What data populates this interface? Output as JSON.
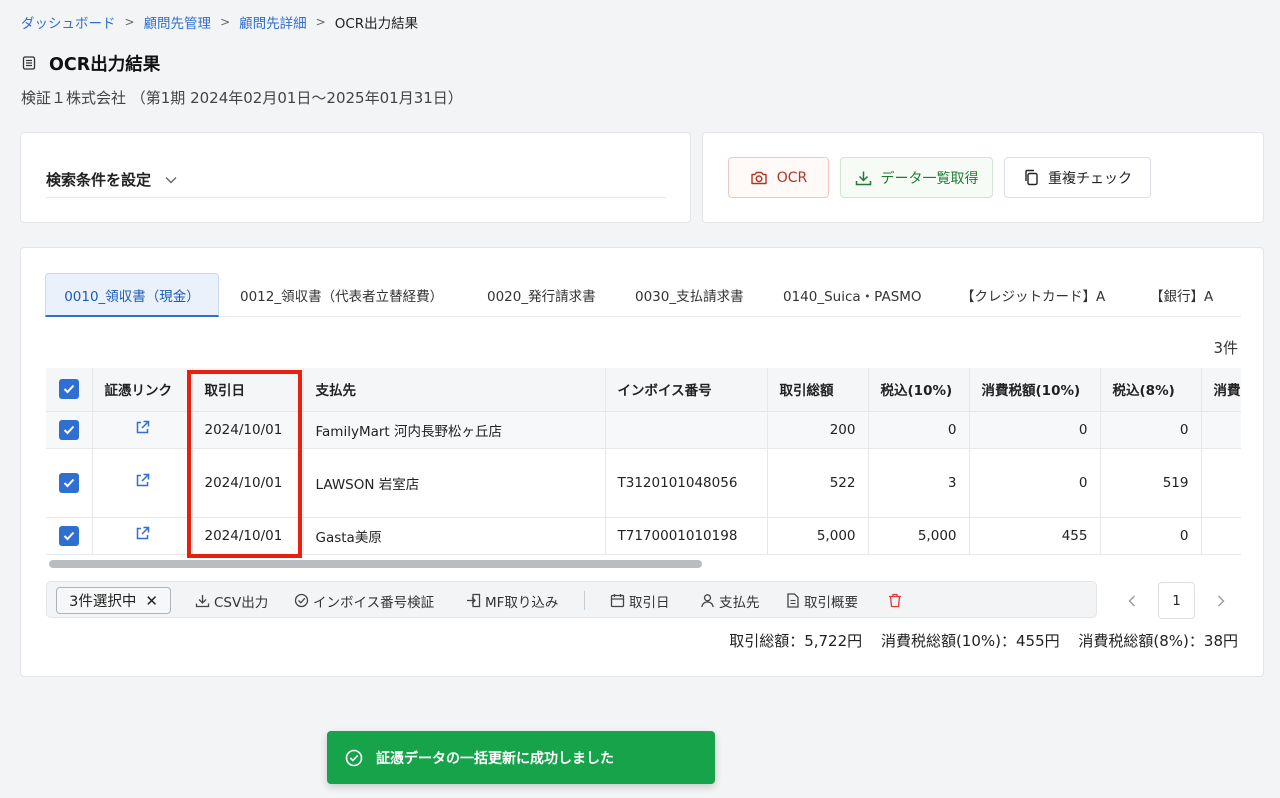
{
  "breadcrumb": {
    "items": [
      "ダッシュボード",
      "顧問先管理",
      "顧問先詳細"
    ],
    "current": "OCR出力結果"
  },
  "page": {
    "title": "OCR出力結果",
    "subtitle": "検証１株式会社 （第1期 2024年02月01日〜2025年01月31日）"
  },
  "search": {
    "label": "検索条件を設定"
  },
  "actions": {
    "ocr": "OCR",
    "download": "データ一覧取得",
    "duplicate": "重複チェック"
  },
  "tabs": [
    "0010_領収書（現金）",
    "0012_領収書（代表者立替経費）",
    "0020_発行請求書",
    "0030_支払請求書",
    "0140_Suica・PASMO",
    "【クレジットカード】A",
    "【銀行】A"
  ],
  "result_count": "3件",
  "table": {
    "headers": [
      "証憑リンク",
      "取引日",
      "支払先",
      "インボイス番号",
      "取引総額",
      "税込(10%)",
      "消費税額(10%)",
      "税込(8%)",
      "消費"
    ],
    "rows": [
      {
        "date": "2024/10/01",
        "payee": "FamilyMart 河内長野松ヶ丘店",
        "invoice": "",
        "total": "200",
        "tax_in_10": "0",
        "tax_10": "0",
        "tax_in_8": "0"
      },
      {
        "date": "2024/10/01",
        "payee": "LAWSON 岩室店",
        "invoice": "T3120101048056",
        "total": "522",
        "tax_in_10": "3",
        "tax_10": "0",
        "tax_in_8": "519"
      },
      {
        "date": "2024/10/01",
        "payee": "Gasta美原",
        "invoice": "T7170001010198",
        "total": "5,000",
        "tax_in_10": "5,000",
        "tax_10": "455",
        "tax_in_8": "0"
      }
    ]
  },
  "bulk": {
    "selected": "3件選択中",
    "csv": "CSV出力",
    "invoice_check": "インボイス番号検証",
    "mf_import": "MF取り込み",
    "date": "取引日",
    "payee": "支払先",
    "summary": "取引概要"
  },
  "pagination": {
    "page": "1"
  },
  "totals": {
    "total": "取引総額：5,722円",
    "tax10": "消費税総額(10%)：455円",
    "tax8": "消費税総額(8%)：38円"
  },
  "toast": {
    "message": "証憑データの一括更新に成功しました"
  },
  "colors": {
    "accent": "#2f6fd1",
    "success": "#16a34a",
    "highlight": "#e8210f",
    "ocr": "#b5341f",
    "download": "#1f7a35"
  }
}
